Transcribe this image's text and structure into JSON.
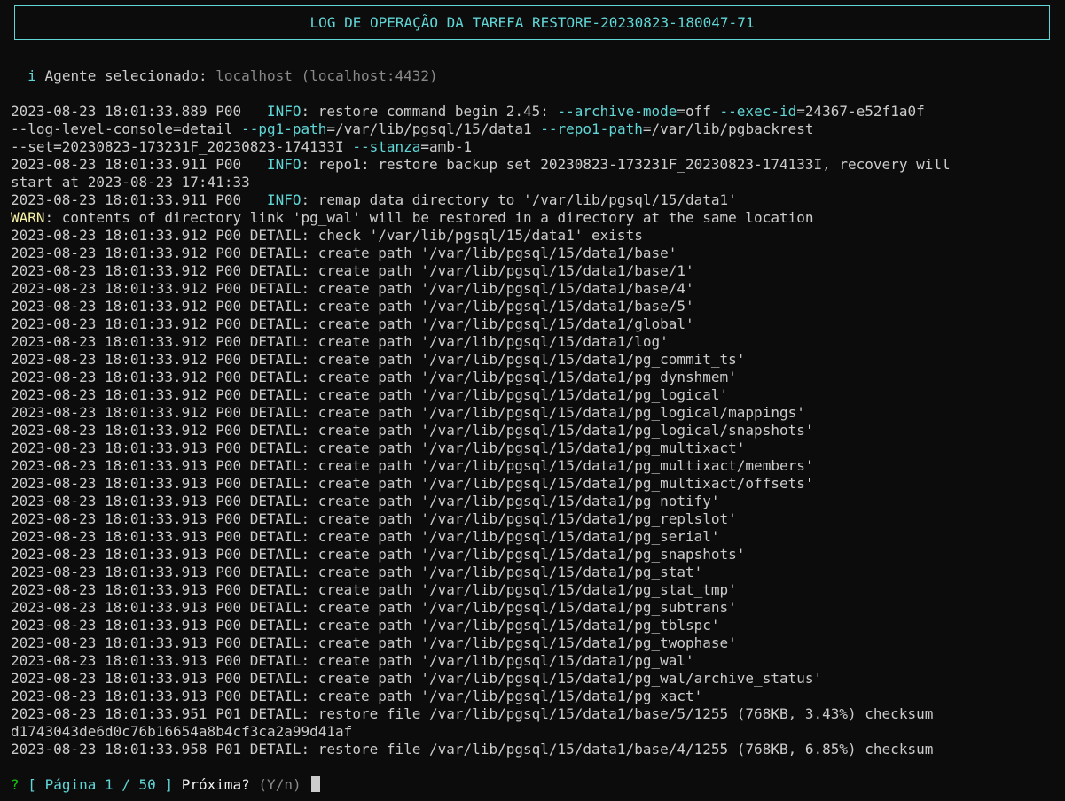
{
  "title": "LOG DE OPERAÇÃO DA TAREFA RESTORE-20230823-180047-71",
  "agent": {
    "icon_glyph": "i",
    "label": "Agente selecionado:",
    "name": "localhost",
    "address": "(localhost:4432)"
  },
  "log_lines": [
    [
      {
        "t": "2023-08-23 18:01:33.889 P00   ",
        "c": ""
      },
      {
        "t": "INFO",
        "c": "cyan"
      },
      {
        "t": ": restore command begin 2.45: ",
        "c": ""
      },
      {
        "t": "--archive-mode",
        "c": "cyan"
      },
      {
        "t": "=off ",
        "c": ""
      },
      {
        "t": "--exec-id",
        "c": "cyan"
      },
      {
        "t": "=24367-e52f1a0f",
        "c": ""
      }
    ],
    [
      {
        "t": "--log-level-console=detail ",
        "c": ""
      },
      {
        "t": "--pg1-path",
        "c": "cyan"
      },
      {
        "t": "=/var/lib/pgsql/15/data1 ",
        "c": ""
      },
      {
        "t": "--repo1-path",
        "c": "cyan"
      },
      {
        "t": "=/var/lib/pgbackrest",
        "c": ""
      }
    ],
    [
      {
        "t": "--set=20230823-173231F_20230823-174133I ",
        "c": ""
      },
      {
        "t": "--stanza",
        "c": "cyan"
      },
      {
        "t": "=amb-1",
        "c": ""
      }
    ],
    [
      {
        "t": "2023-08-23 18:01:33.911 P00   ",
        "c": ""
      },
      {
        "t": "INFO",
        "c": "cyan"
      },
      {
        "t": ": repo1: restore backup set 20230823-173231F_20230823-174133I, recovery will",
        "c": ""
      }
    ],
    [
      {
        "t": "start at 2023-08-23 17:41:33",
        "c": ""
      }
    ],
    [
      {
        "t": "2023-08-23 18:01:33.911 P00   ",
        "c": ""
      },
      {
        "t": "INFO",
        "c": "cyan"
      },
      {
        "t": ": remap data directory to '/var/lib/pgsql/15/data1'",
        "c": ""
      }
    ],
    [
      {
        "t": "WARN",
        "c": "yellow"
      },
      {
        "t": ": contents of directory link 'pg_wal' will be restored in a directory at the same location",
        "c": ""
      }
    ],
    [
      {
        "t": "2023-08-23 18:01:33.912 P00 DETAIL: check '/var/lib/pgsql/15/data1' exists",
        "c": ""
      }
    ],
    [
      {
        "t": "2023-08-23 18:01:33.912 P00 DETAIL: create path '/var/lib/pgsql/15/data1/base'",
        "c": ""
      }
    ],
    [
      {
        "t": "2023-08-23 18:01:33.912 P00 DETAIL: create path '/var/lib/pgsql/15/data1/base/1'",
        "c": ""
      }
    ],
    [
      {
        "t": "2023-08-23 18:01:33.912 P00 DETAIL: create path '/var/lib/pgsql/15/data1/base/4'",
        "c": ""
      }
    ],
    [
      {
        "t": "2023-08-23 18:01:33.912 P00 DETAIL: create path '/var/lib/pgsql/15/data1/base/5'",
        "c": ""
      }
    ],
    [
      {
        "t": "2023-08-23 18:01:33.912 P00 DETAIL: create path '/var/lib/pgsql/15/data1/global'",
        "c": ""
      }
    ],
    [
      {
        "t": "2023-08-23 18:01:33.912 P00 DETAIL: create path '/var/lib/pgsql/15/data1/log'",
        "c": ""
      }
    ],
    [
      {
        "t": "2023-08-23 18:01:33.912 P00 DETAIL: create path '/var/lib/pgsql/15/data1/pg_commit_ts'",
        "c": ""
      }
    ],
    [
      {
        "t": "2023-08-23 18:01:33.912 P00 DETAIL: create path '/var/lib/pgsql/15/data1/pg_dynshmem'",
        "c": ""
      }
    ],
    [
      {
        "t": "2023-08-23 18:01:33.912 P00 DETAIL: create path '/var/lib/pgsql/15/data1/pg_logical'",
        "c": ""
      }
    ],
    [
      {
        "t": "2023-08-23 18:01:33.912 P00 DETAIL: create path '/var/lib/pgsql/15/data1/pg_logical/mappings'",
        "c": ""
      }
    ],
    [
      {
        "t": "2023-08-23 18:01:33.912 P00 DETAIL: create path '/var/lib/pgsql/15/data1/pg_logical/snapshots'",
        "c": ""
      }
    ],
    [
      {
        "t": "2023-08-23 18:01:33.913 P00 DETAIL: create path '/var/lib/pgsql/15/data1/pg_multixact'",
        "c": ""
      }
    ],
    [
      {
        "t": "2023-08-23 18:01:33.913 P00 DETAIL: create path '/var/lib/pgsql/15/data1/pg_multixact/members'",
        "c": ""
      }
    ],
    [
      {
        "t": "2023-08-23 18:01:33.913 P00 DETAIL: create path '/var/lib/pgsql/15/data1/pg_multixact/offsets'",
        "c": ""
      }
    ],
    [
      {
        "t": "2023-08-23 18:01:33.913 P00 DETAIL: create path '/var/lib/pgsql/15/data1/pg_notify'",
        "c": ""
      }
    ],
    [
      {
        "t": "2023-08-23 18:01:33.913 P00 DETAIL: create path '/var/lib/pgsql/15/data1/pg_replslot'",
        "c": ""
      }
    ],
    [
      {
        "t": "2023-08-23 18:01:33.913 P00 DETAIL: create path '/var/lib/pgsql/15/data1/pg_serial'",
        "c": ""
      }
    ],
    [
      {
        "t": "2023-08-23 18:01:33.913 P00 DETAIL: create path '/var/lib/pgsql/15/data1/pg_snapshots'",
        "c": ""
      }
    ],
    [
      {
        "t": "2023-08-23 18:01:33.913 P00 DETAIL: create path '/var/lib/pgsql/15/data1/pg_stat'",
        "c": ""
      }
    ],
    [
      {
        "t": "2023-08-23 18:01:33.913 P00 DETAIL: create path '/var/lib/pgsql/15/data1/pg_stat_tmp'",
        "c": ""
      }
    ],
    [
      {
        "t": "2023-08-23 18:01:33.913 P00 DETAIL: create path '/var/lib/pgsql/15/data1/pg_subtrans'",
        "c": ""
      }
    ],
    [
      {
        "t": "2023-08-23 18:01:33.913 P00 DETAIL: create path '/var/lib/pgsql/15/data1/pg_tblspc'",
        "c": ""
      }
    ],
    [
      {
        "t": "2023-08-23 18:01:33.913 P00 DETAIL: create path '/var/lib/pgsql/15/data1/pg_twophase'",
        "c": ""
      }
    ],
    [
      {
        "t": "2023-08-23 18:01:33.913 P00 DETAIL: create path '/var/lib/pgsql/15/data1/pg_wal'",
        "c": ""
      }
    ],
    [
      {
        "t": "2023-08-23 18:01:33.913 P00 DETAIL: create path '/var/lib/pgsql/15/data1/pg_wal/archive_status'",
        "c": ""
      }
    ],
    [
      {
        "t": "2023-08-23 18:01:33.913 P00 DETAIL: create path '/var/lib/pgsql/15/data1/pg_xact'",
        "c": ""
      }
    ],
    [
      {
        "t": "2023-08-23 18:01:33.951 P01 DETAIL: restore file /var/lib/pgsql/15/data1/base/5/1255 (768KB, 3.43%) checksum",
        "c": ""
      }
    ],
    [
      {
        "t": "d1743043de6d0c76b16654a8b4cf3ca2a99d41af",
        "c": ""
      }
    ],
    [
      {
        "t": "2023-08-23 18:01:33.958 P01 DETAIL: restore file /var/lib/pgsql/15/data1/base/4/1255 (768KB, 6.85%) checksum",
        "c": ""
      }
    ]
  ],
  "prompt": {
    "question_mark": "?",
    "open_bracket": "[",
    "page_label": "Página 1 / 50",
    "close_bracket": "]",
    "next_label": "Próxima?",
    "options": "(Y/n)"
  },
  "colors": {
    "background": "#0c0c0c",
    "foreground": "#cccccc",
    "accent_cyan": "#61d6d6",
    "warn_yellow": "#f9f1a5",
    "prompt_green": "#16c60c",
    "prompt_blue": "#3b78ff"
  }
}
